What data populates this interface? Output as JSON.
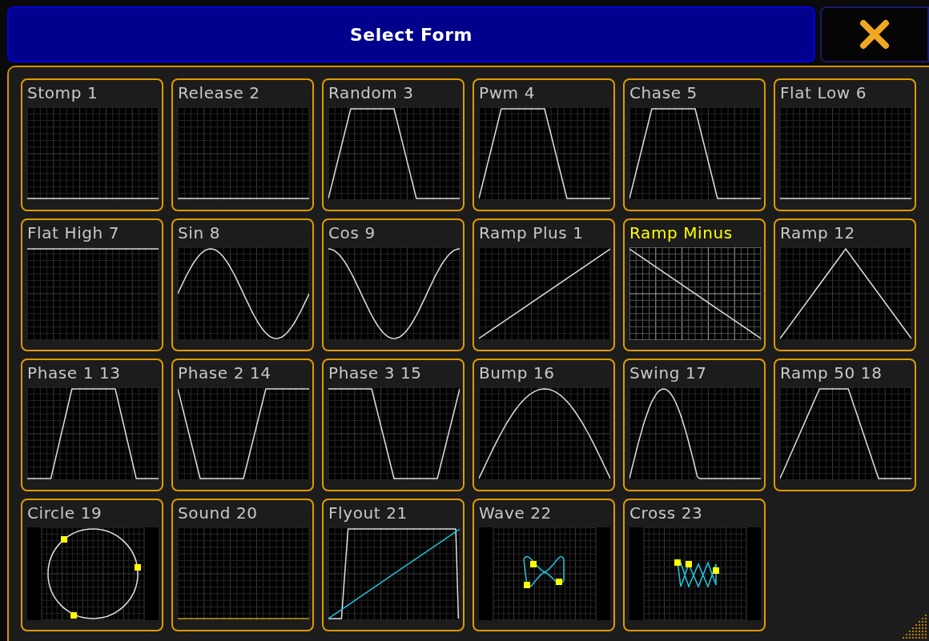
{
  "dialog": {
    "title": "Select Form"
  },
  "forms": [
    {
      "label": "Stomp 1",
      "kind": "flat-low",
      "selected": false
    },
    {
      "label": "Release 2",
      "kind": "flat-low",
      "selected": false
    },
    {
      "label": "Random 3",
      "kind": "trapezoid",
      "selected": false
    },
    {
      "label": "Pwm 4",
      "kind": "trapezoid",
      "selected": false
    },
    {
      "label": "Chase 5",
      "kind": "trapezoid",
      "selected": false
    },
    {
      "label": "Flat Low 6",
      "kind": "flat-low",
      "selected": false
    },
    {
      "label": "Flat High 7",
      "kind": "flat-high",
      "selected": false
    },
    {
      "label": "Sin 8",
      "kind": "sine",
      "selected": false
    },
    {
      "label": "Cos 9",
      "kind": "cosine",
      "selected": false
    },
    {
      "label": "Ramp Plus 1",
      "kind": "ramp-up",
      "selected": false
    },
    {
      "label": "Ramp Minus",
      "kind": "ramp-down",
      "selected": true
    },
    {
      "label": "Ramp 12",
      "kind": "triangle",
      "selected": false
    },
    {
      "label": "Phase 1 13",
      "kind": "phase-1",
      "selected": false
    },
    {
      "label": "Phase 2 14",
      "kind": "phase-2",
      "selected": false
    },
    {
      "label": "Phase 3 15",
      "kind": "phase-3",
      "selected": false
    },
    {
      "label": "Bump 16",
      "kind": "bump",
      "selected": false
    },
    {
      "label": "Swing 17",
      "kind": "swing",
      "selected": false
    },
    {
      "label": "Ramp 50 18",
      "kind": "ramp-50",
      "selected": false
    },
    {
      "label": "Circle 19",
      "kind": "circle",
      "selected": false
    },
    {
      "label": "Sound 20",
      "kind": "sound",
      "selected": false
    },
    {
      "label": "Flyout 21",
      "kind": "flyout",
      "selected": false
    },
    {
      "label": "Wave 22",
      "kind": "wave",
      "selected": false
    },
    {
      "label": "Cross 23",
      "kind": "cross",
      "selected": false
    }
  ]
}
